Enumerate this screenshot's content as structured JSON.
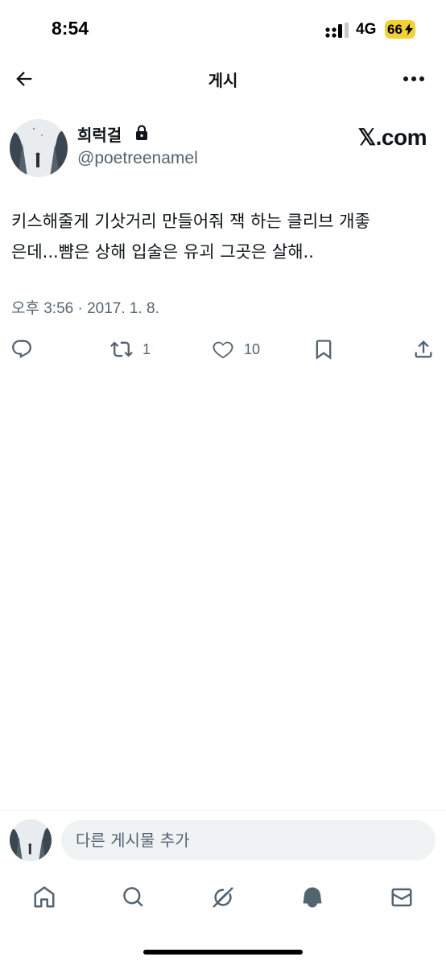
{
  "status_bar": {
    "time": "8:54",
    "network": "4G",
    "battery": "66",
    "battery_color": "#f2d22e"
  },
  "nav": {
    "title": "게시",
    "back_icon": "arrow-left-icon",
    "more_icon": "more-horizontal-icon"
  },
  "post": {
    "author_name": "희럭걸",
    "author_handle": "@poetreenamel",
    "protected_icon": "lock-icon",
    "watermark": "𝕏.com",
    "text_lines": [
      "키스해줄게 기삿거리 만들어줘 잭 하는 클리브 개좋",
      "은데...뺨은 상해 입술은 유괴 그곳은 살해.."
    ],
    "timestamp": "오후 3:56 · 2017. 1. 8.",
    "actions": {
      "reply_icon": "reply-icon",
      "repost_icon": "repost-icon",
      "repost_count": "1",
      "like_icon": "heart-icon",
      "like_count": "10",
      "bookmark_icon": "bookmark-icon",
      "share_icon": "share-icon"
    }
  },
  "compose": {
    "placeholder": "다른 게시물 추가"
  },
  "tabbar": {
    "items": [
      {
        "icon": "home-icon"
      },
      {
        "icon": "search-icon"
      },
      {
        "icon": "grok-icon"
      },
      {
        "icon": "notifications-icon"
      },
      {
        "icon": "messages-icon"
      }
    ]
  },
  "colors": {
    "text_primary": "#0f1419",
    "text_secondary": "#536471",
    "input_bg": "#eff3f4"
  }
}
